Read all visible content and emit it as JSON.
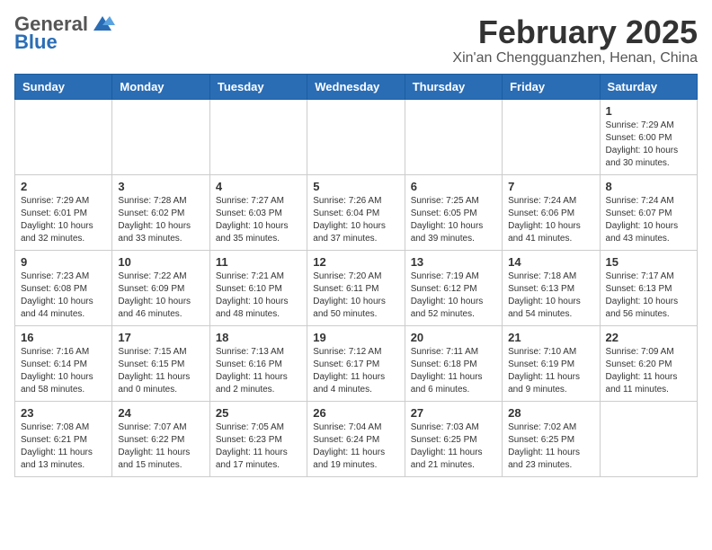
{
  "header": {
    "logo_general": "General",
    "logo_blue": "Blue",
    "month_title": "February 2025",
    "location": "Xin'an Chengguanzhen, Henan, China"
  },
  "weekdays": [
    "Sunday",
    "Monday",
    "Tuesday",
    "Wednesday",
    "Thursday",
    "Friday",
    "Saturday"
  ],
  "weeks": [
    [
      {
        "day": "",
        "info": ""
      },
      {
        "day": "",
        "info": ""
      },
      {
        "day": "",
        "info": ""
      },
      {
        "day": "",
        "info": ""
      },
      {
        "day": "",
        "info": ""
      },
      {
        "day": "",
        "info": ""
      },
      {
        "day": "1",
        "info": "Sunrise: 7:29 AM\nSunset: 6:00 PM\nDaylight: 10 hours\nand 30 minutes."
      }
    ],
    [
      {
        "day": "2",
        "info": "Sunrise: 7:29 AM\nSunset: 6:01 PM\nDaylight: 10 hours\nand 32 minutes."
      },
      {
        "day": "3",
        "info": "Sunrise: 7:28 AM\nSunset: 6:02 PM\nDaylight: 10 hours\nand 33 minutes."
      },
      {
        "day": "4",
        "info": "Sunrise: 7:27 AM\nSunset: 6:03 PM\nDaylight: 10 hours\nand 35 minutes."
      },
      {
        "day": "5",
        "info": "Sunrise: 7:26 AM\nSunset: 6:04 PM\nDaylight: 10 hours\nand 37 minutes."
      },
      {
        "day": "6",
        "info": "Sunrise: 7:25 AM\nSunset: 6:05 PM\nDaylight: 10 hours\nand 39 minutes."
      },
      {
        "day": "7",
        "info": "Sunrise: 7:24 AM\nSunset: 6:06 PM\nDaylight: 10 hours\nand 41 minutes."
      },
      {
        "day": "8",
        "info": "Sunrise: 7:24 AM\nSunset: 6:07 PM\nDaylight: 10 hours\nand 43 minutes."
      }
    ],
    [
      {
        "day": "9",
        "info": "Sunrise: 7:23 AM\nSunset: 6:08 PM\nDaylight: 10 hours\nand 44 minutes."
      },
      {
        "day": "10",
        "info": "Sunrise: 7:22 AM\nSunset: 6:09 PM\nDaylight: 10 hours\nand 46 minutes."
      },
      {
        "day": "11",
        "info": "Sunrise: 7:21 AM\nSunset: 6:10 PM\nDaylight: 10 hours\nand 48 minutes."
      },
      {
        "day": "12",
        "info": "Sunrise: 7:20 AM\nSunset: 6:11 PM\nDaylight: 10 hours\nand 50 minutes."
      },
      {
        "day": "13",
        "info": "Sunrise: 7:19 AM\nSunset: 6:12 PM\nDaylight: 10 hours\nand 52 minutes."
      },
      {
        "day": "14",
        "info": "Sunrise: 7:18 AM\nSunset: 6:13 PM\nDaylight: 10 hours\nand 54 minutes."
      },
      {
        "day": "15",
        "info": "Sunrise: 7:17 AM\nSunset: 6:13 PM\nDaylight: 10 hours\nand 56 minutes."
      }
    ],
    [
      {
        "day": "16",
        "info": "Sunrise: 7:16 AM\nSunset: 6:14 PM\nDaylight: 10 hours\nand 58 minutes."
      },
      {
        "day": "17",
        "info": "Sunrise: 7:15 AM\nSunset: 6:15 PM\nDaylight: 11 hours\nand 0 minutes."
      },
      {
        "day": "18",
        "info": "Sunrise: 7:13 AM\nSunset: 6:16 PM\nDaylight: 11 hours\nand 2 minutes."
      },
      {
        "day": "19",
        "info": "Sunrise: 7:12 AM\nSunset: 6:17 PM\nDaylight: 11 hours\nand 4 minutes."
      },
      {
        "day": "20",
        "info": "Sunrise: 7:11 AM\nSunset: 6:18 PM\nDaylight: 11 hours\nand 6 minutes."
      },
      {
        "day": "21",
        "info": "Sunrise: 7:10 AM\nSunset: 6:19 PM\nDaylight: 11 hours\nand 9 minutes."
      },
      {
        "day": "22",
        "info": "Sunrise: 7:09 AM\nSunset: 6:20 PM\nDaylight: 11 hours\nand 11 minutes."
      }
    ],
    [
      {
        "day": "23",
        "info": "Sunrise: 7:08 AM\nSunset: 6:21 PM\nDaylight: 11 hours\nand 13 minutes."
      },
      {
        "day": "24",
        "info": "Sunrise: 7:07 AM\nSunset: 6:22 PM\nDaylight: 11 hours\nand 15 minutes."
      },
      {
        "day": "25",
        "info": "Sunrise: 7:05 AM\nSunset: 6:23 PM\nDaylight: 11 hours\nand 17 minutes."
      },
      {
        "day": "26",
        "info": "Sunrise: 7:04 AM\nSunset: 6:24 PM\nDaylight: 11 hours\nand 19 minutes."
      },
      {
        "day": "27",
        "info": "Sunrise: 7:03 AM\nSunset: 6:25 PM\nDaylight: 11 hours\nand 21 minutes."
      },
      {
        "day": "28",
        "info": "Sunrise: 7:02 AM\nSunset: 6:25 PM\nDaylight: 11 hours\nand 23 minutes."
      },
      {
        "day": "",
        "info": ""
      }
    ]
  ]
}
